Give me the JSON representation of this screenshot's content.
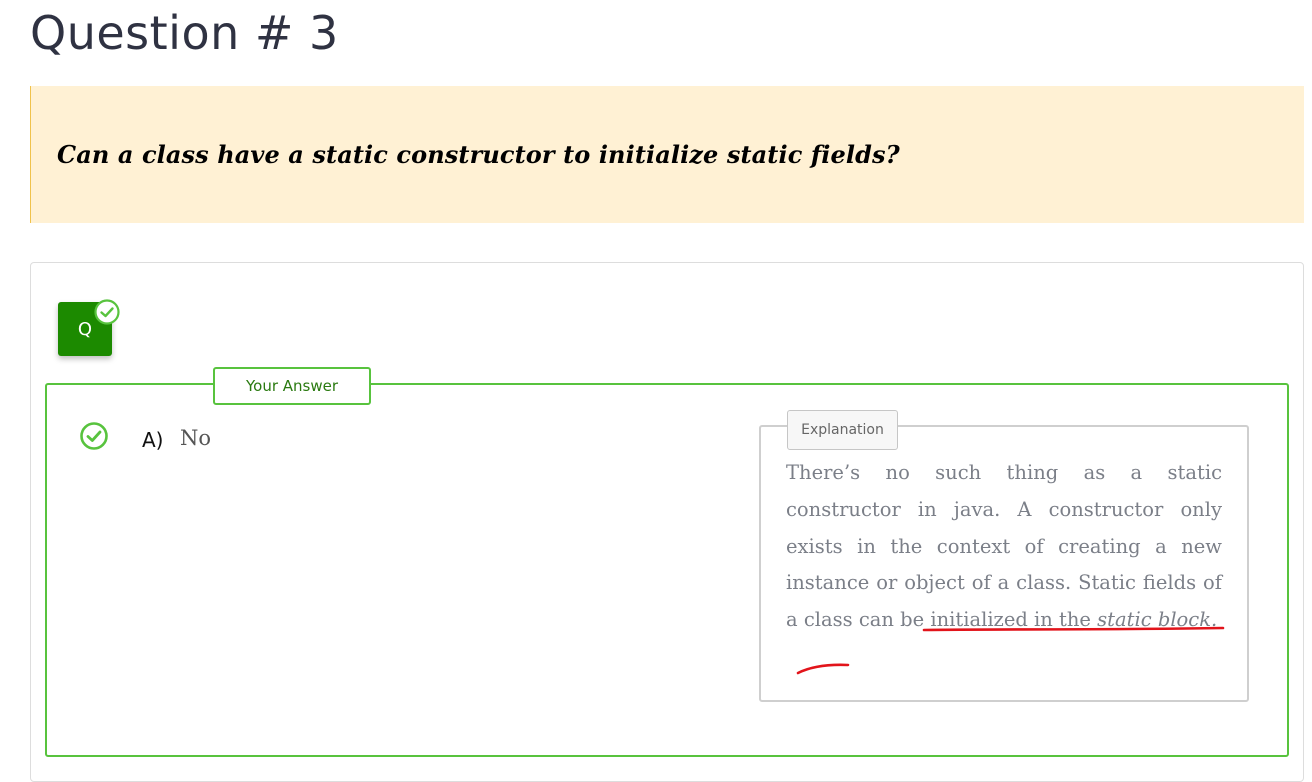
{
  "header": {
    "title": "Question # 3"
  },
  "question": {
    "text": "Can a class have a static constructor to initialize static fields?"
  },
  "badge": {
    "label": "Q",
    "status_icon": "check-circle-icon",
    "color": "#1c8a00"
  },
  "answer_section": {
    "tag_label": "Your Answer",
    "accent_color": "#58c33e",
    "selected": {
      "letter": "A)",
      "text": "No",
      "status_icon": "check-circle-icon"
    }
  },
  "explanation": {
    "tag_label": "Explanation",
    "text_part1": "There’s no such thing as a static constructor in java. A constructor only exists in the context of creating a new instance or object of a class. Static fields of a class can be initialized in the ",
    "text_em": "static block.",
    "annotation": "red hand-drawn underline"
  }
}
